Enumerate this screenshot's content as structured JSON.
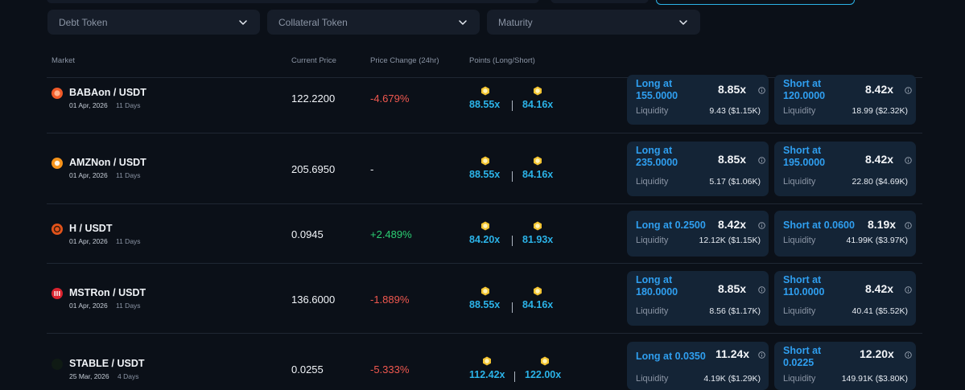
{
  "filters": {
    "debt_token": "Debt Token",
    "collateral_token": "Collateral Token",
    "maturity": "Maturity"
  },
  "table": {
    "headers": {
      "market": "Market",
      "current_price": "Current Price",
      "price_change": "Price Change (24hr)",
      "points": "Points (Long/Short)"
    }
  },
  "colors": {
    "background": "#0b1018",
    "card": "#142436",
    "accent": "#2f9ff0",
    "negative": "#f0584f",
    "positive": "#2bcf73"
  },
  "rows": [
    {
      "name": "BABAon / USDT",
      "date": "01 Apr, 2026",
      "days": "11 Days",
      "coin_icon": "baba-coin-icon",
      "coin_color": "#f05a28",
      "price": "122.2200",
      "change": "-4.679%",
      "trend": "neg",
      "points_long": "88.55x",
      "points_short": "84.16x",
      "long": {
        "line1": "Long at",
        "line2": "155.0000",
        "leverage": "8.85x",
        "liq_label": "Liquidity",
        "liquidity": "9.43 ($1.15K)"
      },
      "short": {
        "line1": "Short at",
        "line2": "120.0000",
        "leverage": "8.42x",
        "liq_label": "Liquidity",
        "liquidity": "18.99 ($2.32K)"
      }
    },
    {
      "name": "AMZNon / USDT",
      "date": "01 Apr, 2026",
      "days": "11 Days",
      "coin_icon": "amzn-coin-icon",
      "coin_color": "#f7931a",
      "price": "205.6950",
      "change": "-",
      "trend": "neu",
      "points_long": "88.55x",
      "points_short": "84.16x",
      "long": {
        "line1": "Long at",
        "line2": "235.0000",
        "leverage": "8.85x",
        "liq_label": "Liquidity",
        "liquidity": "5.17 ($1.06K)"
      },
      "short": {
        "line1": "Short at",
        "line2": "195.0000",
        "leverage": "8.42x",
        "liq_label": "Liquidity",
        "liquidity": "22.80 ($4.69K)"
      }
    },
    {
      "name": "H / USDT",
      "date": "01 Apr, 2026",
      "days": "11 Days",
      "coin_icon": "h-coin-icon",
      "coin_color": "#e2531b",
      "price": "0.0945",
      "change": "+2.489%",
      "trend": "pos",
      "points_long": "84.20x",
      "points_short": "81.93x",
      "long": {
        "line1": "Long at 0.2500",
        "line2": "",
        "leverage": "8.42x",
        "liq_label": "Liquidity",
        "liquidity": "12.12K ($1.15K)"
      },
      "short": {
        "line1": "Short at 0.0600",
        "line2": "",
        "leverage": "8.19x",
        "liq_label": "Liquidity",
        "liquidity": "41.99K ($3.97K)"
      }
    },
    {
      "name": "MSTRon / USDT",
      "date": "01 Apr, 2026",
      "days": "11 Days",
      "coin_icon": "mstr-coin-icon",
      "coin_color": "#d9232e",
      "price": "136.6000",
      "change": "-1.889%",
      "trend": "neg",
      "points_long": "88.55x",
      "points_short": "84.16x",
      "long": {
        "line1": "Long at",
        "line2": "180.0000",
        "leverage": "8.85x",
        "liq_label": "Liquidity",
        "liquidity": "8.56 ($1.17K)"
      },
      "short": {
        "line1": "Short at",
        "line2": "110.0000",
        "leverage": "8.42x",
        "liq_label": "Liquidity",
        "liquidity": "40.41 ($5.52K)"
      }
    },
    {
      "name": "STABLE / USDT",
      "date": "25 Mar, 2026",
      "days": "4 Days",
      "coin_icon": "stable-coin-icon",
      "coin_color": "#0f1a14",
      "price": "0.0255",
      "change": "-5.333%",
      "trend": "neg",
      "points_long": "112.42x",
      "points_short": "122.00x",
      "long": {
        "line1": "Long at 0.0350",
        "line2": "",
        "leverage": "11.24x",
        "liq_label": "Liquidity",
        "liquidity": "4.19K ($1.29K)"
      },
      "short": {
        "line1": "Short at",
        "line2": "0.0225",
        "leverage": "12.20x",
        "liq_label": "Liquidity",
        "liquidity": "149.91K ($3.80K)"
      }
    }
  ]
}
